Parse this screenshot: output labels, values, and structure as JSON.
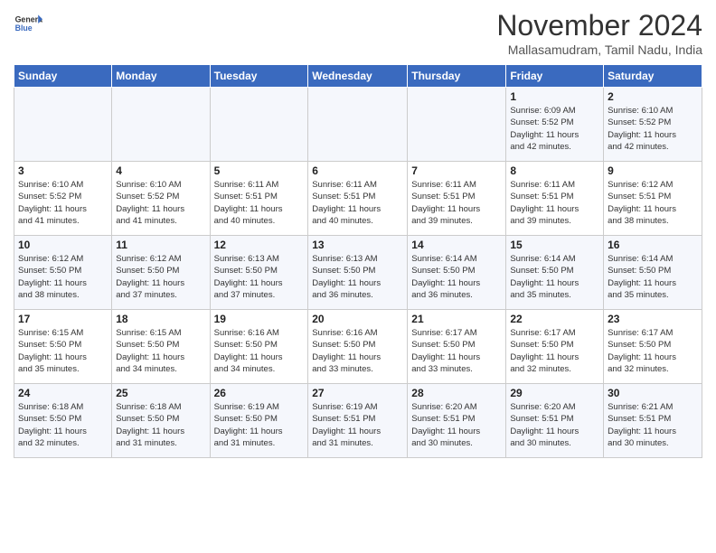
{
  "header": {
    "logo": {
      "general": "General",
      "blue": "Blue"
    },
    "month_year": "November 2024",
    "location": "Mallasamudram, Tamil Nadu, India"
  },
  "weekdays": [
    "Sunday",
    "Monday",
    "Tuesday",
    "Wednesday",
    "Thursday",
    "Friday",
    "Saturday"
  ],
  "weeks": [
    [
      {
        "day": "",
        "info": ""
      },
      {
        "day": "",
        "info": ""
      },
      {
        "day": "",
        "info": ""
      },
      {
        "day": "",
        "info": ""
      },
      {
        "day": "",
        "info": ""
      },
      {
        "day": "1",
        "info": "Sunrise: 6:09 AM\nSunset: 5:52 PM\nDaylight: 11 hours\nand 42 minutes."
      },
      {
        "day": "2",
        "info": "Sunrise: 6:10 AM\nSunset: 5:52 PM\nDaylight: 11 hours\nand 42 minutes."
      }
    ],
    [
      {
        "day": "3",
        "info": "Sunrise: 6:10 AM\nSunset: 5:52 PM\nDaylight: 11 hours\nand 41 minutes."
      },
      {
        "day": "4",
        "info": "Sunrise: 6:10 AM\nSunset: 5:52 PM\nDaylight: 11 hours\nand 41 minutes."
      },
      {
        "day": "5",
        "info": "Sunrise: 6:11 AM\nSunset: 5:51 PM\nDaylight: 11 hours\nand 40 minutes."
      },
      {
        "day": "6",
        "info": "Sunrise: 6:11 AM\nSunset: 5:51 PM\nDaylight: 11 hours\nand 40 minutes."
      },
      {
        "day": "7",
        "info": "Sunrise: 6:11 AM\nSunset: 5:51 PM\nDaylight: 11 hours\nand 39 minutes."
      },
      {
        "day": "8",
        "info": "Sunrise: 6:11 AM\nSunset: 5:51 PM\nDaylight: 11 hours\nand 39 minutes."
      },
      {
        "day": "9",
        "info": "Sunrise: 6:12 AM\nSunset: 5:51 PM\nDaylight: 11 hours\nand 38 minutes."
      }
    ],
    [
      {
        "day": "10",
        "info": "Sunrise: 6:12 AM\nSunset: 5:50 PM\nDaylight: 11 hours\nand 38 minutes."
      },
      {
        "day": "11",
        "info": "Sunrise: 6:12 AM\nSunset: 5:50 PM\nDaylight: 11 hours\nand 37 minutes."
      },
      {
        "day": "12",
        "info": "Sunrise: 6:13 AM\nSunset: 5:50 PM\nDaylight: 11 hours\nand 37 minutes."
      },
      {
        "day": "13",
        "info": "Sunrise: 6:13 AM\nSunset: 5:50 PM\nDaylight: 11 hours\nand 36 minutes."
      },
      {
        "day": "14",
        "info": "Sunrise: 6:14 AM\nSunset: 5:50 PM\nDaylight: 11 hours\nand 36 minutes."
      },
      {
        "day": "15",
        "info": "Sunrise: 6:14 AM\nSunset: 5:50 PM\nDaylight: 11 hours\nand 35 minutes."
      },
      {
        "day": "16",
        "info": "Sunrise: 6:14 AM\nSunset: 5:50 PM\nDaylight: 11 hours\nand 35 minutes."
      }
    ],
    [
      {
        "day": "17",
        "info": "Sunrise: 6:15 AM\nSunset: 5:50 PM\nDaylight: 11 hours\nand 35 minutes."
      },
      {
        "day": "18",
        "info": "Sunrise: 6:15 AM\nSunset: 5:50 PM\nDaylight: 11 hours\nand 34 minutes."
      },
      {
        "day": "19",
        "info": "Sunrise: 6:16 AM\nSunset: 5:50 PM\nDaylight: 11 hours\nand 34 minutes."
      },
      {
        "day": "20",
        "info": "Sunrise: 6:16 AM\nSunset: 5:50 PM\nDaylight: 11 hours\nand 33 minutes."
      },
      {
        "day": "21",
        "info": "Sunrise: 6:17 AM\nSunset: 5:50 PM\nDaylight: 11 hours\nand 33 minutes."
      },
      {
        "day": "22",
        "info": "Sunrise: 6:17 AM\nSunset: 5:50 PM\nDaylight: 11 hours\nand 32 minutes."
      },
      {
        "day": "23",
        "info": "Sunrise: 6:17 AM\nSunset: 5:50 PM\nDaylight: 11 hours\nand 32 minutes."
      }
    ],
    [
      {
        "day": "24",
        "info": "Sunrise: 6:18 AM\nSunset: 5:50 PM\nDaylight: 11 hours\nand 32 minutes."
      },
      {
        "day": "25",
        "info": "Sunrise: 6:18 AM\nSunset: 5:50 PM\nDaylight: 11 hours\nand 31 minutes."
      },
      {
        "day": "26",
        "info": "Sunrise: 6:19 AM\nSunset: 5:50 PM\nDaylight: 11 hours\nand 31 minutes."
      },
      {
        "day": "27",
        "info": "Sunrise: 6:19 AM\nSunset: 5:51 PM\nDaylight: 11 hours\nand 31 minutes."
      },
      {
        "day": "28",
        "info": "Sunrise: 6:20 AM\nSunset: 5:51 PM\nDaylight: 11 hours\nand 30 minutes."
      },
      {
        "day": "29",
        "info": "Sunrise: 6:20 AM\nSunset: 5:51 PM\nDaylight: 11 hours\nand 30 minutes."
      },
      {
        "day": "30",
        "info": "Sunrise: 6:21 AM\nSunset: 5:51 PM\nDaylight: 11 hours\nand 30 minutes."
      }
    ]
  ]
}
